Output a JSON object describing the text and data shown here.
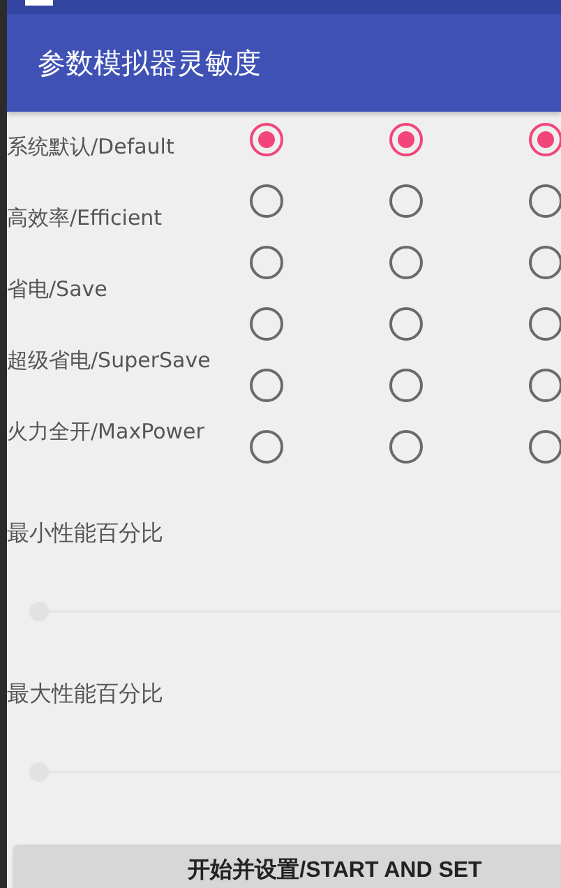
{
  "app_bar": {
    "title": "参数模拟器灵敏度"
  },
  "modes": [
    "系统默认/Default",
    "高效率/Efficient",
    "省电/Save",
    "超级省电/SuperSave",
    "火力全开/MaxPower"
  ],
  "radio_groups": [
    {
      "options": [
        {
          "selected": true
        },
        {
          "selected": false
        },
        {
          "selected": false
        },
        {
          "selected": false
        },
        {
          "selected": false
        },
        {
          "selected": false
        }
      ]
    },
    {
      "options": [
        {
          "selected": true
        },
        {
          "selected": false
        },
        {
          "selected": false
        },
        {
          "selected": false
        },
        {
          "selected": false
        },
        {
          "selected": false
        }
      ]
    },
    {
      "options": [
        {
          "selected": true
        },
        {
          "selected": false
        },
        {
          "selected": false
        },
        {
          "selected": false
        },
        {
          "selected": false
        },
        {
          "selected": false
        }
      ]
    }
  ],
  "sliders": [
    {
      "label": "最小性能百分比",
      "level": 0
    },
    {
      "label": "最大性能百分比",
      "level": 0
    }
  ],
  "button": "开始并设置/START AND SET"
}
